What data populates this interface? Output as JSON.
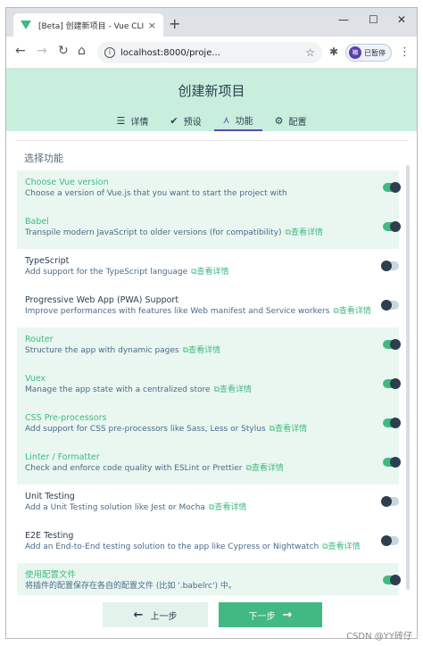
{
  "browser": {
    "tab_title": "[Beta] 创建新项目 - Vue CLI",
    "tab_close": "×",
    "new_tab": "+",
    "minimize": "—",
    "maximize": "☐",
    "close": "✕",
    "url": "localhost:8000/proje...",
    "profile_initial": "嘛",
    "profile_label": "已暂停"
  },
  "page": {
    "title": "创建新项目",
    "tabs": [
      {
        "label": "详情",
        "icon": "list-icon"
      },
      {
        "label": "预设",
        "icon": "check-circle-icon"
      },
      {
        "label": "功能",
        "icon": "fork-icon",
        "active": true
      },
      {
        "label": "配置",
        "icon": "settings-icon"
      }
    ],
    "section_title": "选择功能",
    "more_label": "查看详情",
    "features": [
      {
        "name": "Choose Vue version",
        "desc": "Choose a version of Vue.js that you want to start the project with",
        "enabled": true,
        "more": false
      },
      {
        "name": "Babel",
        "desc": "Transpile modern JavaScript to older versions (for compatibility)",
        "enabled": true,
        "more": true
      },
      {
        "name": "TypeScript",
        "desc": "Add support for the TypeScript language",
        "enabled": false,
        "more": true
      },
      {
        "name": "Progressive Web App (PWA) Support",
        "desc": "Improve performances with features like Web manifest and Service workers",
        "enabled": false,
        "more": true
      },
      {
        "name": "Router",
        "desc": "Structure the app with dynamic pages",
        "enabled": true,
        "more": true
      },
      {
        "name": "Vuex",
        "desc": "Manage the app state with a centralized store",
        "enabled": true,
        "more": true
      },
      {
        "name": "CSS Pre-processors",
        "desc": "Add support for CSS pre-processors like Sass, Less or Stylus",
        "enabled": true,
        "more": true
      },
      {
        "name": "Linter / Formatter",
        "desc": "Check and enforce code quality with ESLint or Prettier",
        "enabled": true,
        "more": true
      },
      {
        "name": "Unit Testing",
        "desc": "Add a Unit Testing solution like Jest or Mocha",
        "enabled": false,
        "more": true
      },
      {
        "name": "E2E Testing",
        "desc": "Add an End-to-End testing solution to the app like Cypress or Nightwatch",
        "enabled": false,
        "more": true
      },
      {
        "name": "使用配置文件",
        "desc": "将插件的配置保存在各自的配置文件 (比如 '.babelrc') 中。",
        "enabled": true,
        "more": false
      }
    ],
    "prev_label": "上一步",
    "next_label": "下一步"
  },
  "watermark": "CSDN @YY砖仔",
  "colors": {
    "accent": "#42b983",
    "header_bg": "#c8eedd",
    "active_tab": "#5a4ab8"
  }
}
